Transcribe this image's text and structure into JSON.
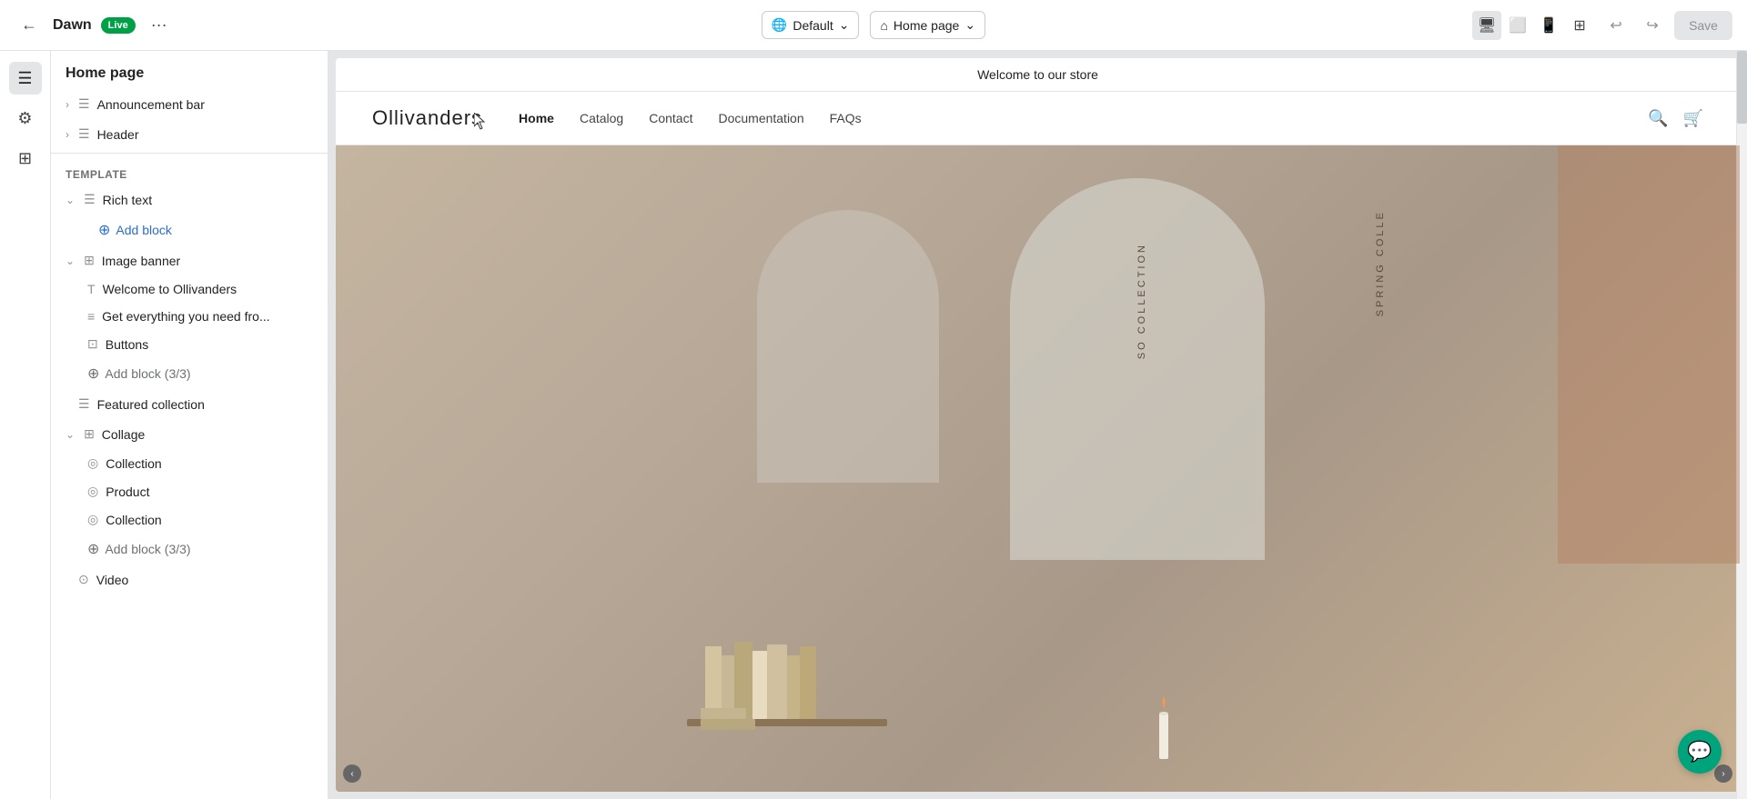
{
  "topbar": {
    "back_label": "←",
    "app_name": "Dawn",
    "live_label": "Live",
    "more_label": "···",
    "globe_label": "Default",
    "home_label": "Home page",
    "save_label": "Save",
    "undo_label": "↩",
    "redo_label": "↪"
  },
  "panel": {
    "title": "Home page",
    "items": [
      {
        "id": "announcement-bar",
        "label": "Announcement bar",
        "type": "section",
        "icon": "☰",
        "expanded": false
      },
      {
        "id": "header",
        "label": "Header",
        "type": "section",
        "icon": "☰",
        "expanded": false
      }
    ],
    "template_label": "Template",
    "template_items": [
      {
        "id": "rich-text",
        "label": "Rich text",
        "type": "section",
        "icon": "☰",
        "expanded": true
      },
      {
        "id": "add-block-rich",
        "label": "Add block",
        "type": "add",
        "color": "blue"
      },
      {
        "id": "image-banner",
        "label": "Image banner",
        "type": "section",
        "icon": "⊞",
        "expanded": true
      },
      {
        "id": "welcome-title",
        "label": "Welcome to Ollivanders",
        "type": "sub",
        "icon": "T"
      },
      {
        "id": "get-everything",
        "label": "Get everything you need fro...",
        "type": "sub",
        "icon": "≡"
      },
      {
        "id": "buttons",
        "label": "Buttons",
        "type": "sub",
        "icon": "⊡"
      },
      {
        "id": "add-block-banner",
        "label": "Add block (3/3)",
        "type": "add-gray"
      },
      {
        "id": "featured-collection",
        "label": "Featured collection",
        "type": "section-flat",
        "icon": "☰"
      },
      {
        "id": "collage",
        "label": "Collage",
        "type": "section",
        "icon": "⊞",
        "expanded": true
      },
      {
        "id": "collection-1",
        "label": "Collection",
        "type": "sub",
        "icon": "◎"
      },
      {
        "id": "product",
        "label": "Product",
        "type": "sub",
        "icon": "◎"
      },
      {
        "id": "collection-2",
        "label": "Collection",
        "type": "sub",
        "icon": "◎"
      },
      {
        "id": "add-block-collage",
        "label": "Add block (3/3)",
        "type": "add-gray"
      },
      {
        "id": "video",
        "label": "Video",
        "type": "section-flat",
        "icon": "⊙"
      }
    ]
  },
  "store": {
    "announcement": "Welcome to our store",
    "logo": "Ollivanders",
    "nav_links": [
      {
        "label": "Home",
        "active": true
      },
      {
        "label": "Catalog",
        "active": false
      },
      {
        "label": "Contact",
        "active": false
      },
      {
        "label": "Documentation",
        "active": false
      },
      {
        "label": "FAQs",
        "active": false
      }
    ],
    "vertical_text_1": "SO COLLECTION",
    "vertical_text_2": "SPRING COLLE"
  },
  "icons": {
    "back": "←",
    "globe": "🌐",
    "home": "⌂",
    "chevron_down": "⌄",
    "desktop": "🖥",
    "tablet": "⬜",
    "mobile": "📱",
    "zoom": "⊞",
    "search": "🔍",
    "cart": "🛒",
    "chat": "💬",
    "pages": "☰",
    "settings": "⚙",
    "apps": "⊞"
  }
}
